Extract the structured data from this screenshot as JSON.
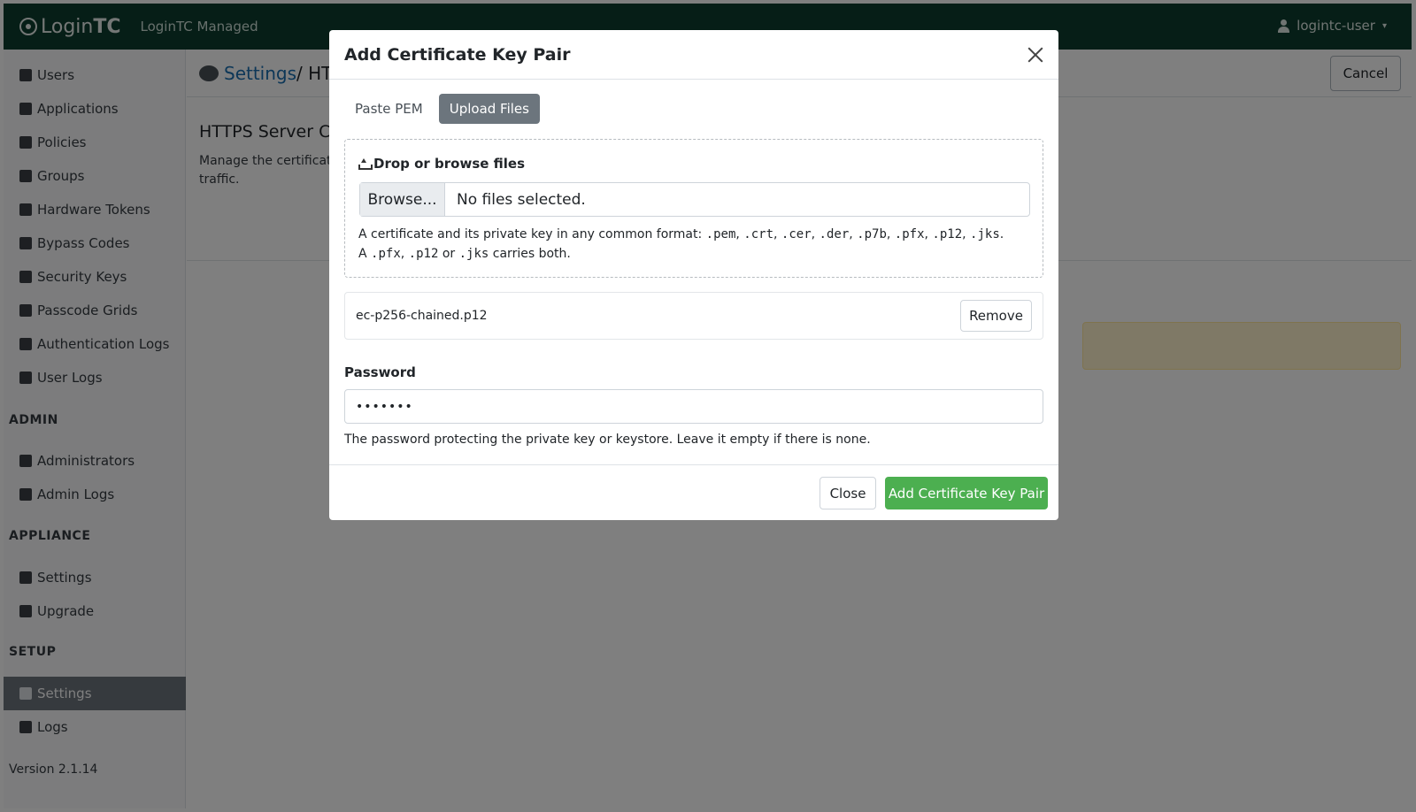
{
  "app": {
    "brand_login": "Login",
    "brand_tc": "TC",
    "subbrand": "LoginTC Managed",
    "user": "logintc-user"
  },
  "sidebar": {
    "items": [
      {
        "label": "Users"
      },
      {
        "label": "Applications"
      },
      {
        "label": "Policies"
      },
      {
        "label": "Groups"
      },
      {
        "label": "Hardware Tokens"
      },
      {
        "label": "Bypass Codes"
      },
      {
        "label": "Security Keys"
      },
      {
        "label": "Passcode Grids"
      },
      {
        "label": "Authentication Logs"
      },
      {
        "label": "User Logs"
      }
    ],
    "admin_heading": "ADMIN",
    "admin_items": [
      {
        "label": "Administrators"
      },
      {
        "label": "Admin Logs"
      }
    ],
    "appliance_heading": "APPLIANCE",
    "appliance_items": [
      {
        "label": "Settings"
      },
      {
        "label": "Upgrade"
      }
    ],
    "setup_heading": "SETUP",
    "setup_items": [
      {
        "label": "Settings"
      },
      {
        "label": "Logs"
      }
    ],
    "version": "Version 2.1.14"
  },
  "content": {
    "crumb_link": "Settings",
    "crumb_rest": " / HTT",
    "cancel": "Cancel",
    "section_title": "HTTPS Server Cer",
    "section_desc": "Manage the certificate traffic."
  },
  "modal": {
    "title": "Add Certificate Key Pair",
    "tabs": [
      {
        "label": "Paste PEM"
      },
      {
        "label": "Upload Files"
      }
    ],
    "dropzone_title": "Drop or browse files",
    "browse": "Browse...",
    "file_status": "No files selected.",
    "help_prefix": "A certificate and its private key in any common format: ",
    "formats": [
      ".pem",
      ".crt",
      ".cer",
      ".der",
      ".p7b",
      ".pfx",
      ".p12",
      ".jks"
    ],
    "help_mid": ". A ",
    "help_or": " or ",
    "help_suffix": " carries both.",
    "selected_file": "ec-p256-chained.p12",
    "remove": "Remove",
    "password_label": "Password",
    "password_value": "•••••••",
    "password_help": "The password protecting the private key or keystore. Leave it empty if there is none.",
    "close": "Close",
    "submit": "Add Certificate Key Pair"
  },
  "colors": {
    "topbar": "#0d3d2f",
    "active_tab": "#6c757d",
    "primary_action": "#4caf50"
  }
}
